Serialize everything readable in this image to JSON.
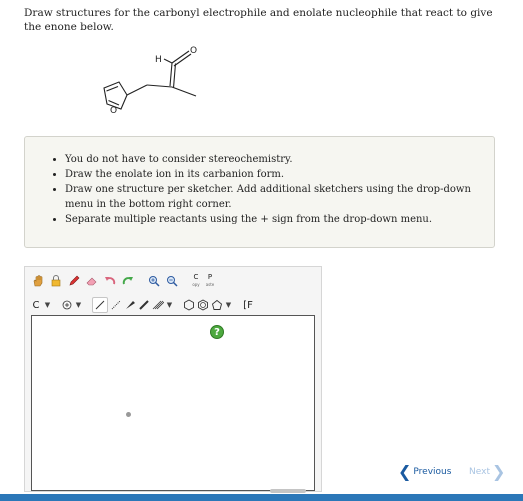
{
  "question": "Draw structures for the carbonyl electrophile and enolate nucleophile that react to give the enone below.",
  "molecule": {
    "h_label": "H",
    "o_carbonyl_label": "O",
    "o_ring_label": "O"
  },
  "instructions": [
    "You do not have to consider stereochemistry.",
    "Draw the enolate ion in its carbanion form.",
    "Draw one structure per sketcher. Add additional sketchers using the drop-down menu in the bottom right corner.",
    "Separate multiple reactants using the + sign from the drop-down menu."
  ],
  "toolbar": {
    "copy_top": "C",
    "copy_bot": "opy",
    "paste_top": "P",
    "paste_bot": "aste",
    "element": "C",
    "bracket": "[F"
  },
  "help_label": "?",
  "nav": {
    "previous": "Previous",
    "next": "Next"
  },
  "colors": {
    "accent": "#2b77b8",
    "help": "#4da93f",
    "link": "#1a5aa0"
  }
}
